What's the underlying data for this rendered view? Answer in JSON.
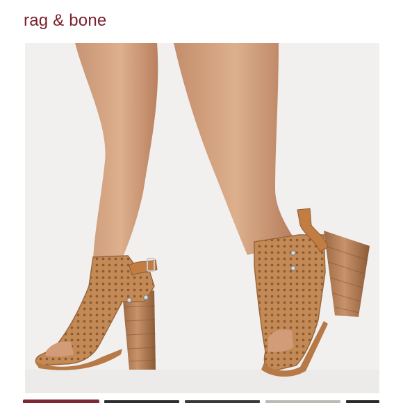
{
  "header": {
    "brand": "rag & bone"
  },
  "listing": {
    "main_image_icon": "product-photo-heeled-sandals"
  },
  "thumbnails": [
    {
      "icon": "thumbnail-image",
      "color": "#7b2a35",
      "selected": true
    },
    {
      "icon": "thumbnail-image",
      "color": "#2f2f2f",
      "selected": false
    },
    {
      "icon": "thumbnail-image",
      "color": "#3a3a3a",
      "selected": false
    },
    {
      "icon": "thumbnail-image",
      "color": "#bdbab6",
      "selected": false
    },
    {
      "icon": "thumbnail-image",
      "color": "#2a2a2a",
      "selected": false
    }
  ],
  "colors": {
    "brand": "#7a1f2b",
    "background": "#f1f0ef",
    "shoe_tan": "#c58a58",
    "skin": "#d8a27f"
  }
}
